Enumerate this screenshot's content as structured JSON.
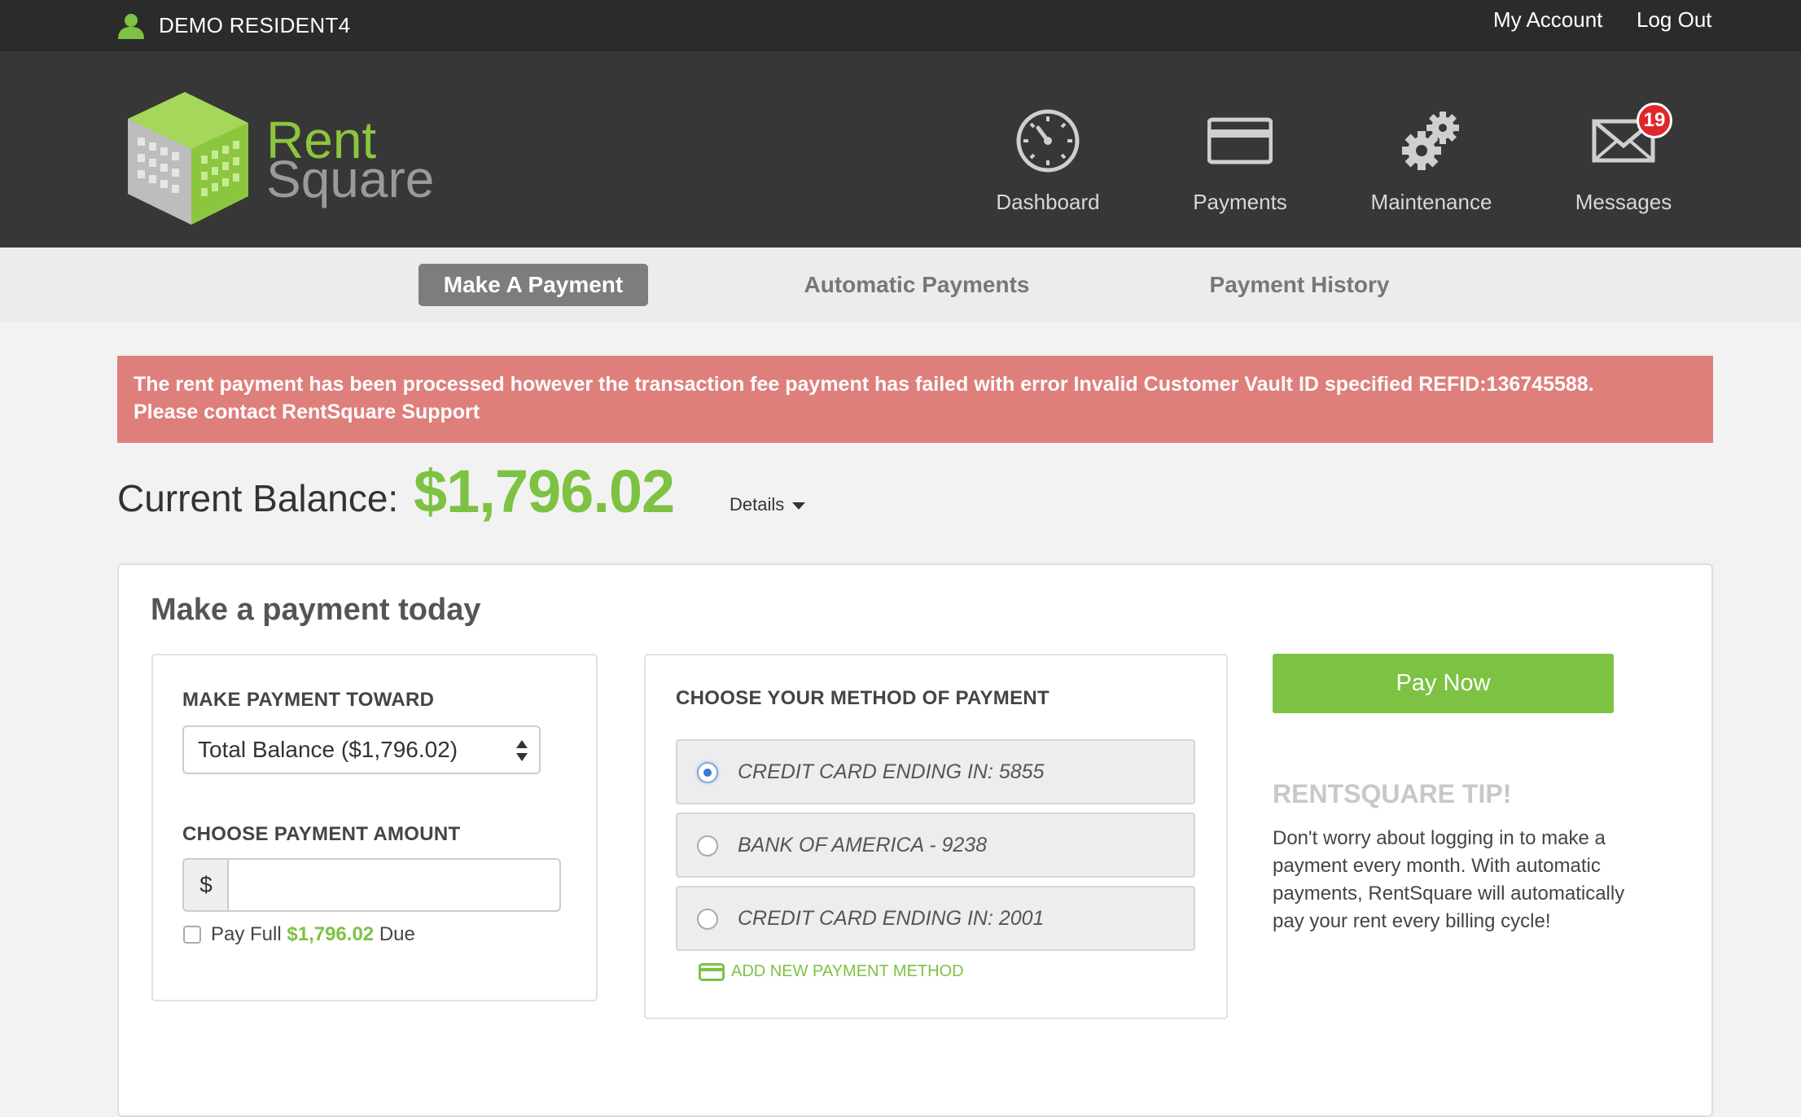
{
  "topbar": {
    "user_name": "DEMO RESIDENT4",
    "my_account": "My Account",
    "log_out": "Log Out"
  },
  "header": {
    "logo_line1": "Rent",
    "logo_line2": "Square",
    "nav": [
      {
        "label": "Dashboard",
        "icon": "gauge-icon"
      },
      {
        "label": "Payments",
        "icon": "credit-card-icon"
      },
      {
        "label": "Maintenance",
        "icon": "gears-icon"
      },
      {
        "label": "Messages",
        "icon": "envelope-icon",
        "badge": "19"
      }
    ]
  },
  "subnav": {
    "tabs": [
      {
        "label": "Make A Payment",
        "active": true
      },
      {
        "label": "Automatic Payments",
        "active": false
      },
      {
        "label": "Payment History",
        "active": false
      }
    ]
  },
  "alert": {
    "line1": "The rent payment has been processed however the transaction fee payment has failed with error Invalid Customer Vault ID specified REFID:136745588.",
    "line2": "Please contact RentSquare Support"
  },
  "balance": {
    "label": "Current Balance:",
    "value": "$1,796.02",
    "details": "Details"
  },
  "payment_card": {
    "title": "Make a payment today",
    "toward": {
      "heading": "MAKE PAYMENT TOWARD",
      "selected": "Total Balance ($1,796.02)"
    },
    "amount": {
      "heading": "CHOOSE PAYMENT AMOUNT",
      "currency": "$",
      "value": "",
      "placeholder": "",
      "pay_full_prefix": "Pay Full",
      "pay_full_amount": "$1,796.02",
      "pay_full_suffix": "Due"
    },
    "method": {
      "heading": "CHOOSE YOUR METHOD OF PAYMENT",
      "options": [
        {
          "label": "CREDIT CARD ENDING IN: 5855",
          "checked": true
        },
        {
          "label": "BANK OF AMERICA - 9238",
          "checked": false
        },
        {
          "label": "CREDIT CARD ENDING IN: 2001",
          "checked": false
        }
      ],
      "add_new": "ADD NEW PAYMENT METHOD"
    },
    "pay_now": "Pay Now",
    "tip": {
      "title": "RENTSQUARE TIP!",
      "body": "Don't worry about logging in to make a payment every month. With automatic payments, RentSquare will automatically pay your rent every billing cycle!"
    }
  },
  "colors": {
    "accent_green": "#7dc242",
    "alert_red": "#de7f7b",
    "dark_header": "#373737",
    "badge_red": "#e0262b"
  }
}
